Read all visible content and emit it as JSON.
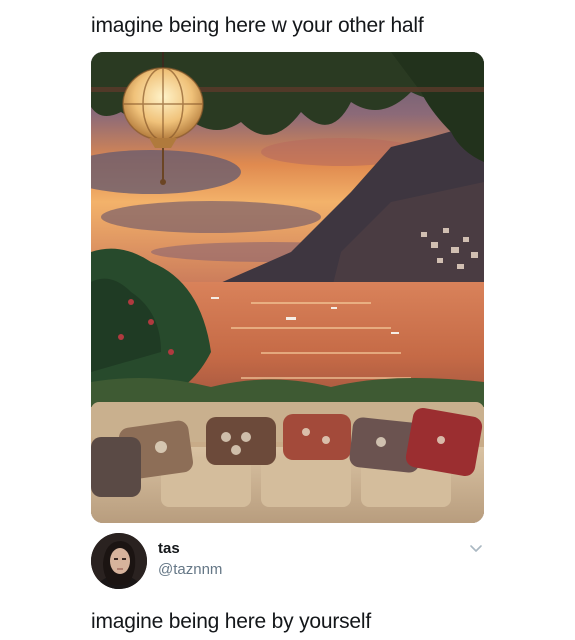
{
  "caption": {
    "top": "imagine being here w your other half",
    "bottom": "imagine being here by yourself"
  },
  "user": {
    "display_name": "tas",
    "handle": "@taznnm"
  },
  "photo": {
    "description_icon": "sunset-coastal-terrace-photo"
  },
  "icons": {
    "more": "chevron-down-icon"
  }
}
